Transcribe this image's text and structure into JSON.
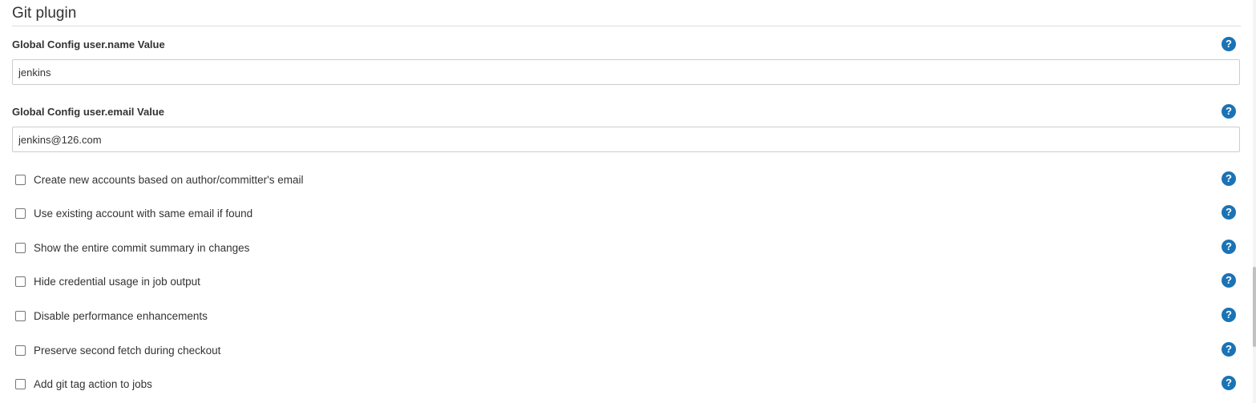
{
  "section": {
    "title": "Git plugin"
  },
  "fields": {
    "user_name": {
      "label": "Global Config user.name Value",
      "value": "jenkins"
    },
    "user_email": {
      "label": "Global Config user.email Value",
      "value": "jenkins@126.com"
    }
  },
  "options": [
    {
      "label": "Create new accounts based on author/committer's email",
      "checked": false
    },
    {
      "label": "Use existing account with same email if found",
      "checked": false
    },
    {
      "label": "Show the entire commit summary in changes",
      "checked": false
    },
    {
      "label": "Hide credential usage in job output",
      "checked": false
    },
    {
      "label": "Disable performance enhancements",
      "checked": false
    },
    {
      "label": "Preserve second fetch during checkout",
      "checked": false
    },
    {
      "label": "Add git tag action to jobs",
      "checked": false
    }
  ],
  "help": {
    "glyph": "?",
    "icon": "help-icon",
    "color": "#1a73b5"
  }
}
